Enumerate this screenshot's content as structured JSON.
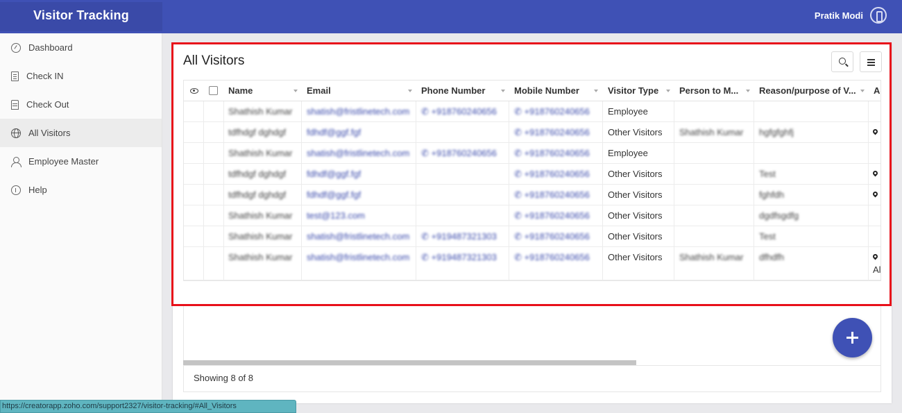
{
  "app": {
    "title": "Visitor Tracking",
    "user_name": "Pratik Modi"
  },
  "sidebar": {
    "items": [
      {
        "label": "Dashboard",
        "icon": "dashboard-icon"
      },
      {
        "label": "Check IN",
        "icon": "check-in-icon"
      },
      {
        "label": "Check Out",
        "icon": "check-out-icon"
      },
      {
        "label": "All Visitors",
        "icon": "globe-icon",
        "active": true
      },
      {
        "label": "Employee Master",
        "icon": "user-icon"
      },
      {
        "label": "Help",
        "icon": "help-icon"
      }
    ]
  },
  "main": {
    "title": "All Visitors",
    "columns": [
      "Name",
      "Email",
      "Phone Number",
      "Mobile Number",
      "Visitor Type",
      "Person to M...",
      "Reason/purpose of V...",
      "Ac"
    ],
    "rows": [
      {
        "name": "Shathish Kumar",
        "email": "shatish@fristlinetech.com",
        "phone": "+918760240656",
        "mobile": "+918760240656",
        "type": "Employee",
        "person": "",
        "reason": "",
        "pin": false,
        "extra": ""
      },
      {
        "name": "tdfhdgf dghdgf",
        "email": "fdhdf@ggf.fgf",
        "phone": "",
        "mobile": "+918760240656",
        "type": "Other Visitors",
        "person": "Shathish Kumar",
        "reason": "hgfgfghfj",
        "pin": true,
        "extra": ""
      },
      {
        "name": "Shathish Kumar",
        "email": "shatish@fristlinetech.com",
        "phone": "+918760240656",
        "mobile": "+918760240656",
        "type": "Employee",
        "person": "",
        "reason": "",
        "pin": false,
        "extra": ""
      },
      {
        "name": "tdfhdgf dghdgf",
        "email": "fdhdf@ggf.fgf",
        "phone": "",
        "mobile": "+918760240656",
        "type": "Other Visitors",
        "person": "",
        "reason": "Test",
        "pin": true,
        "extra": ""
      },
      {
        "name": "tdfhdgf dghdgf",
        "email": "fdhdf@ggf.fgf",
        "phone": "",
        "mobile": "+918760240656",
        "type": "Other Visitors",
        "person": "",
        "reason": "fghfdh",
        "pin": true,
        "extra": ""
      },
      {
        "name": "Shathish Kumar",
        "email": "test@123.com",
        "phone": "",
        "mobile": "+918760240656",
        "type": "Other Visitors",
        "person": "",
        "reason": "dgdfsgdfg",
        "pin": false,
        "extra": ""
      },
      {
        "name": "Shathish Kumar",
        "email": "shatish@fristlinetech.com",
        "phone": "+919487321303",
        "mobile": "+918760240656",
        "type": "Other Visitors",
        "person": "",
        "reason": "Test",
        "pin": false,
        "extra": ""
      },
      {
        "name": "Shathish Kumar",
        "email": "shatish@fristlinetech.com",
        "phone": "+919487321303",
        "mobile": "+918760240656",
        "type": "Other Visitors",
        "person": "Shathish Kumar",
        "reason": "dfhdfh",
        "pin": true,
        "extra": "Al"
      }
    ],
    "footer": "Showing 8 of 8"
  },
  "status_url": "https://creatorapp.zoho.com/support2327/visitor-tracking/#All_Visitors",
  "colors": {
    "primary": "#3f51b5",
    "highlight": "#e8101a",
    "link": "#3949ab"
  }
}
